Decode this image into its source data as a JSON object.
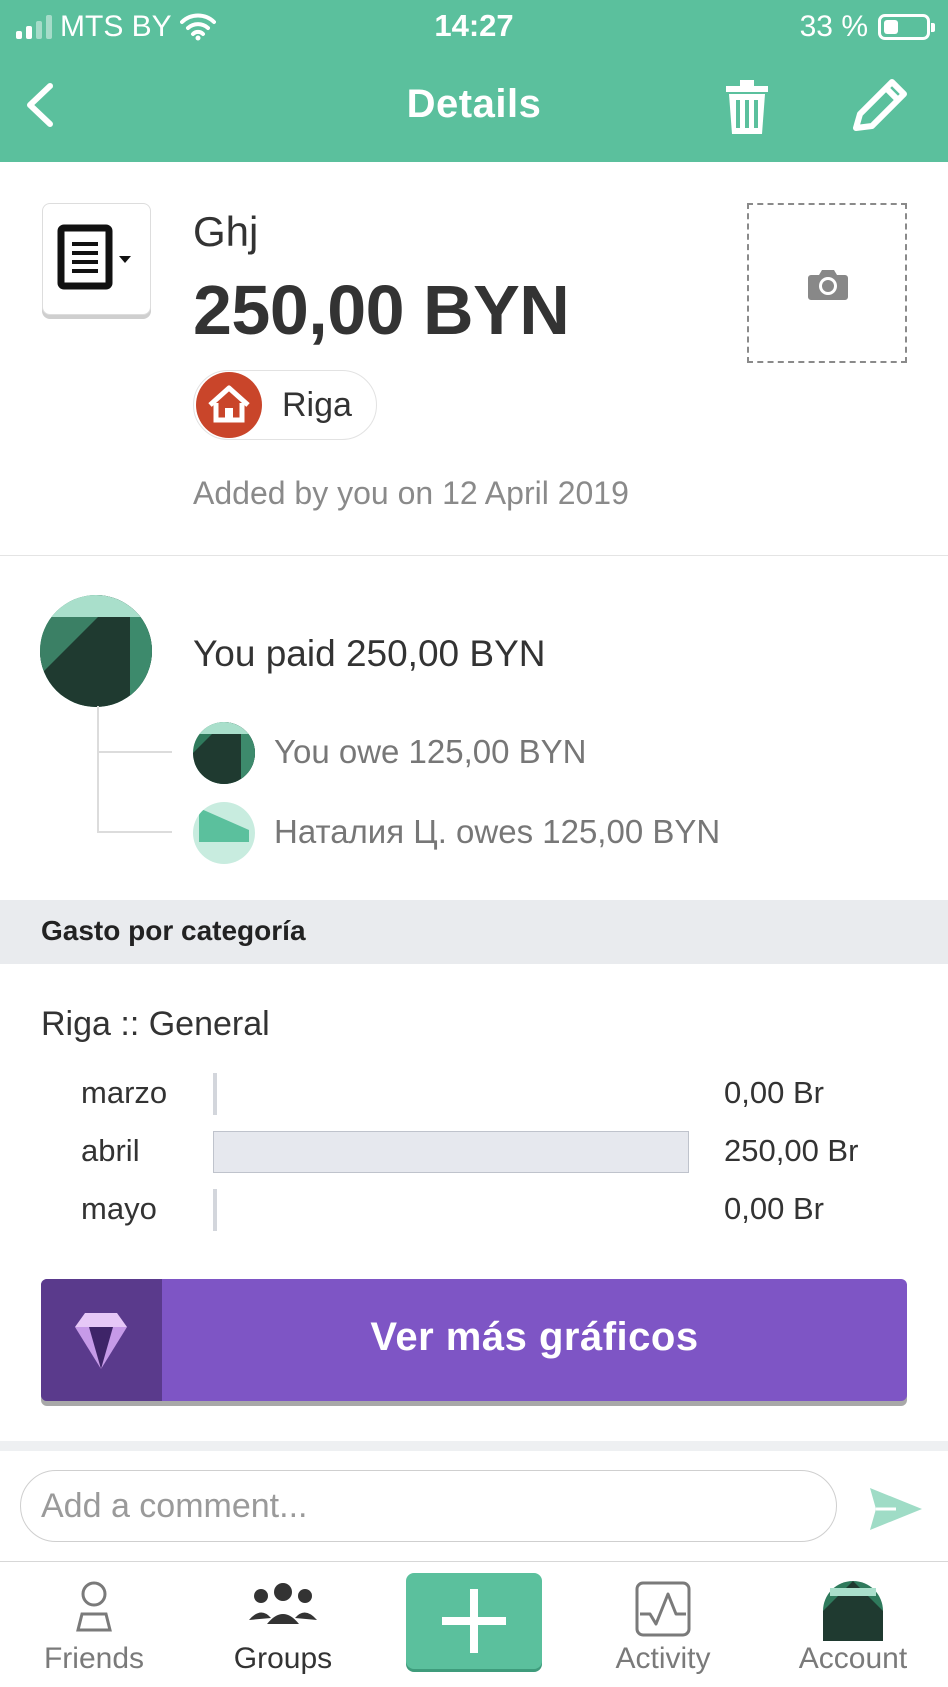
{
  "status_bar": {
    "carrier": "MTS BY",
    "time": "14:27",
    "battery": "33 %",
    "battery_level": 0.33
  },
  "nav": {
    "title": "Details"
  },
  "expense": {
    "description": "Ghj",
    "amount": "250,00 BYN",
    "group": "Riga",
    "added_by": "Added by you on 12 April 2019"
  },
  "split": {
    "paid_line": "You paid 250,00 BYN",
    "shares": [
      {
        "text": "You owe 125,00 BYN"
      },
      {
        "text": "Наталия Ц. owes 125,00 BYN"
      }
    ]
  },
  "category_spending": {
    "section_title": "Gasto por categoría",
    "category": "Riga :: General",
    "rows": [
      {
        "month": "marzo",
        "value": "0,00 Br",
        "amount": 0
      },
      {
        "month": "abril",
        "value": "250,00 Br",
        "amount": 250
      },
      {
        "month": "mayo",
        "value": "0,00 Br",
        "amount": 0
      }
    ],
    "more_button": "Ver más gráficos"
  },
  "comment": {
    "placeholder": "Add a comment..."
  },
  "tabs": [
    {
      "label": "Friends",
      "icon": "person-icon"
    },
    {
      "label": "Groups",
      "icon": "group-icon"
    },
    {
      "label": "",
      "icon": "plus-icon"
    },
    {
      "label": "Activity",
      "icon": "activity-icon"
    },
    {
      "label": "Account",
      "icon": "avatar-icon"
    }
  ],
  "colors": {
    "brand": "#5bc09d",
    "purple": "#7e55c5",
    "group_avatar": "#c9452a"
  }
}
